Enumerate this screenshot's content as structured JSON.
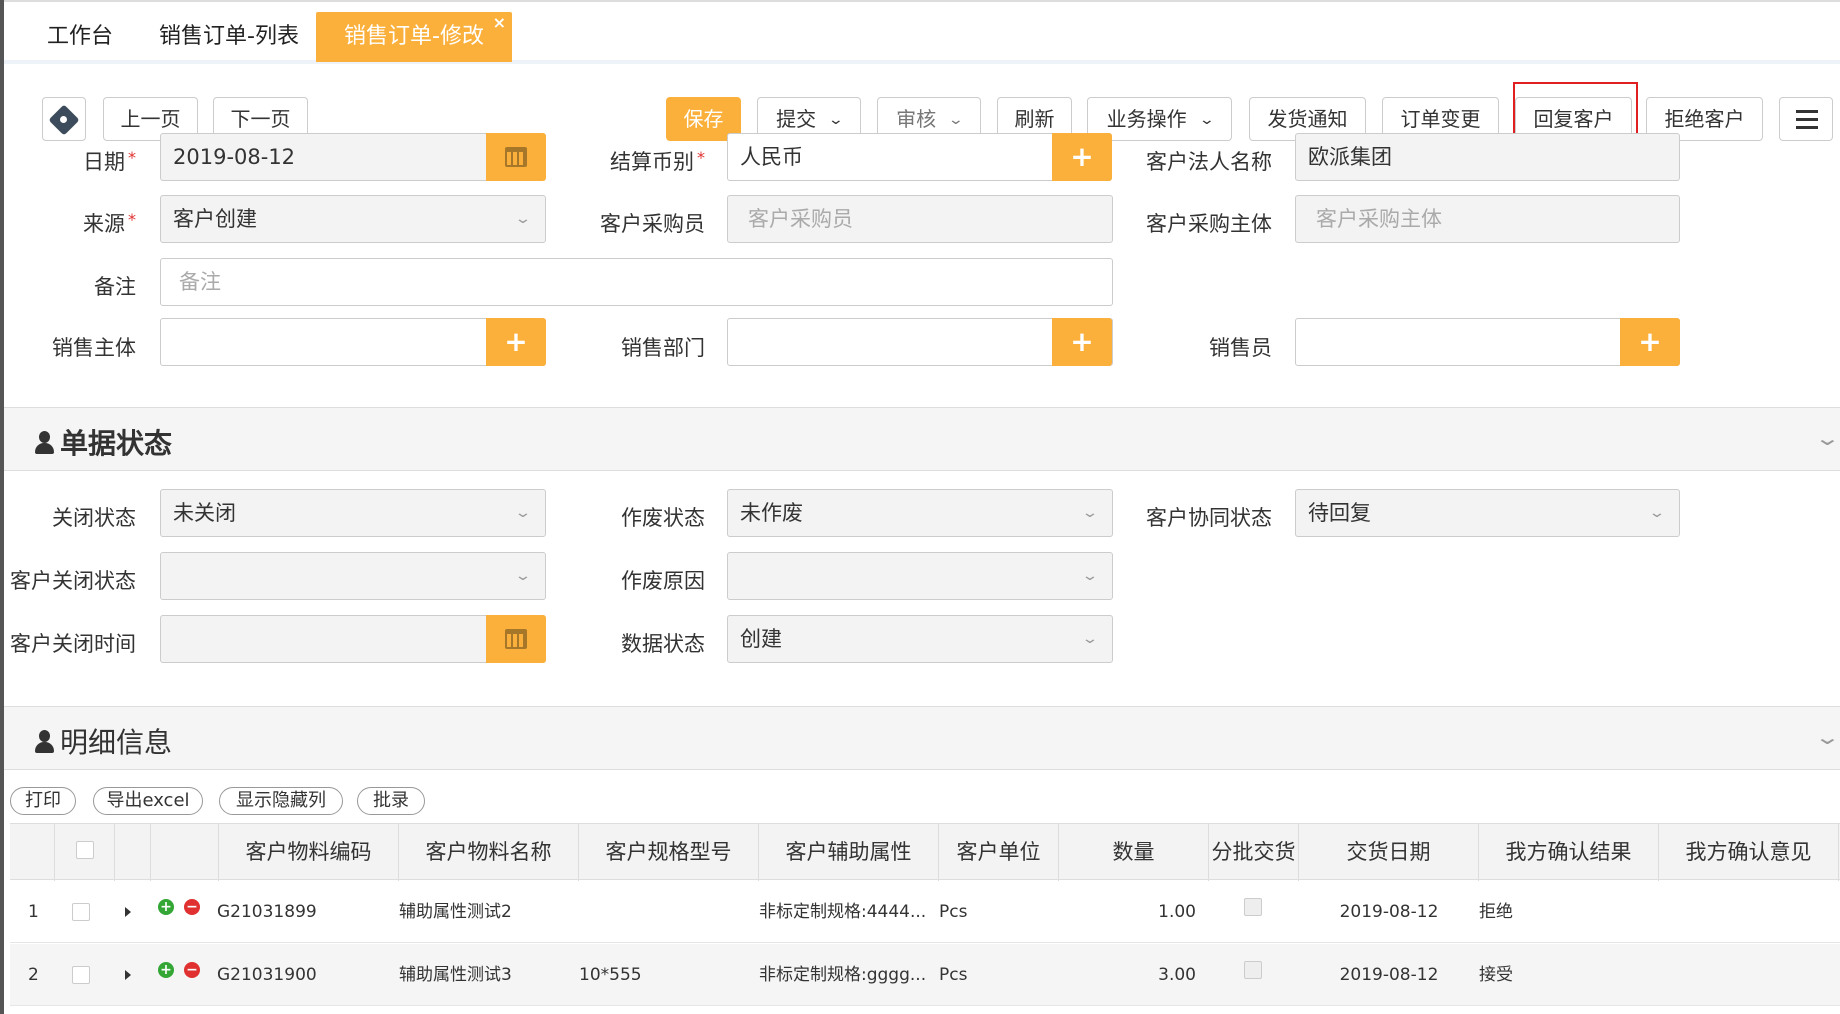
{
  "tabs": [
    {
      "label": "工作台"
    },
    {
      "label": "销售订单-列表"
    },
    {
      "label": "销售订单-修改",
      "close": "×"
    }
  ],
  "toolbar": {
    "prev": "上一页",
    "next": "下一页",
    "save": "保存",
    "submit": "提交",
    "audit": "审核",
    "refresh": "刷新",
    "business": "业务操作",
    "ship_notice": "发货通知",
    "order_change": "订单变更",
    "reply_customer": "回复客户",
    "reject_customer": "拒绝客户",
    "chevron": "⌄"
  },
  "form": {
    "date_label": "日期",
    "date_value": "2019-08-12",
    "currency_label": "结算币别",
    "currency_value": "人民币",
    "legal_name_label": "客户法人名称",
    "legal_name_value": "欧派集团",
    "source_label": "来源",
    "source_value": "客户创建",
    "buyer_label": "客户采购员",
    "buyer_placeholder": "客户采购员",
    "buyer_entity_label": "客户采购主体",
    "buyer_entity_placeholder": "客户采购主体",
    "remark_label": "备注",
    "remark_placeholder": "备注",
    "sales_entity_label": "销售主体",
    "sales_dept_label": "销售部门",
    "salesman_label": "销售员",
    "required_mark": "*"
  },
  "status_section": {
    "title": "单据状态",
    "close_status_label": "关闭状态",
    "close_status_value": "未关闭",
    "void_status_label": "作废状态",
    "void_status_value": "未作废",
    "collab_status_label": "客户协同状态",
    "collab_status_value": "待回复",
    "cust_close_status_label": "客户关闭状态",
    "void_reason_label": "作废原因",
    "cust_close_time_label": "客户关闭时间",
    "data_status_label": "数据状态",
    "data_status_value": "创建"
  },
  "detail_section": {
    "title": "明细信息",
    "buttons": {
      "print": "打印",
      "export": "导出excel",
      "show_hidden": "显示隐藏列",
      "batch": "批录"
    }
  },
  "table": {
    "columns": [
      "客户物料编码",
      "客户物料名称",
      "客户规格型号",
      "客户辅助属性",
      "客户单位",
      "数量",
      "分批交货",
      "交货日期",
      "我方确认结果",
      "我方确认意见"
    ],
    "rows": [
      {
        "index": "1",
        "code": "G21031899",
        "name": "辅助属性测试2",
        "spec": "",
        "attr": "非标定制规格:4444...",
        "unit": "Pcs",
        "qty": "1.00",
        "date": "2019-08-12",
        "result": "拒绝",
        "opinion": ""
      },
      {
        "index": "2",
        "code": "G21031900",
        "name": "辅助属性测试3",
        "spec": "10*555",
        "attr": "非标定制规格:gggg...",
        "unit": "Pcs",
        "qty": "3.00",
        "date": "2019-08-12",
        "result": "接受",
        "opinion": ""
      }
    ]
  },
  "colors": {
    "accent": "#fbb03b",
    "highlight": "#e02020"
  }
}
